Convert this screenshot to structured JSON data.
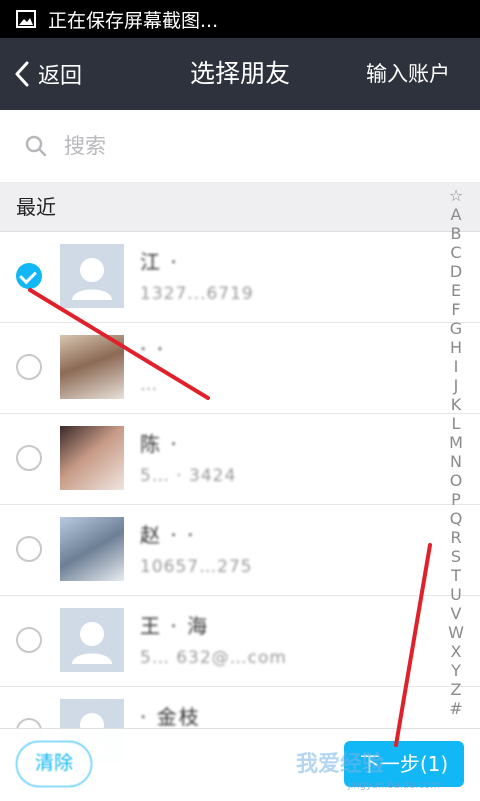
{
  "status_bar": {
    "message": "正在保存屏幕截图..."
  },
  "nav": {
    "back_label": "返回",
    "title": "选择朋友",
    "right_action": "输入账户"
  },
  "search": {
    "placeholder": "搜索"
  },
  "section": {
    "title": "最近"
  },
  "contacts": [
    {
      "name": "江 ·",
      "detail": "1327...6719",
      "checked": true
    },
    {
      "name": "· ·",
      "detail": "…",
      "checked": false
    },
    {
      "name": "陈 ·",
      "detail": "5… · 3424",
      "checked": false
    },
    {
      "name": "赵 · ·",
      "detail": "10657…275",
      "checked": false
    },
    {
      "name": "王 · 海",
      "detail": "5… 632@…com",
      "checked": false
    },
    {
      "name": "· 金枝",
      "detail": "",
      "checked": false
    }
  ],
  "index_letters": [
    "☆",
    "A",
    "B",
    "C",
    "D",
    "E",
    "F",
    "G",
    "H",
    "I",
    "J",
    "K",
    "L",
    "M",
    "N",
    "O",
    "P",
    "Q",
    "R",
    "S",
    "T",
    "U",
    "V",
    "W",
    "X",
    "Y",
    "Z",
    "#"
  ],
  "bottom": {
    "left_button": "清除",
    "next_button": "下一步(1)"
  },
  "watermark": {
    "text": "我爱经验",
    "url": "jingyan.baidu.com"
  },
  "colors": {
    "accent": "#12b7f5",
    "navbar": "#2e323c",
    "annotation": "#e0202a"
  }
}
